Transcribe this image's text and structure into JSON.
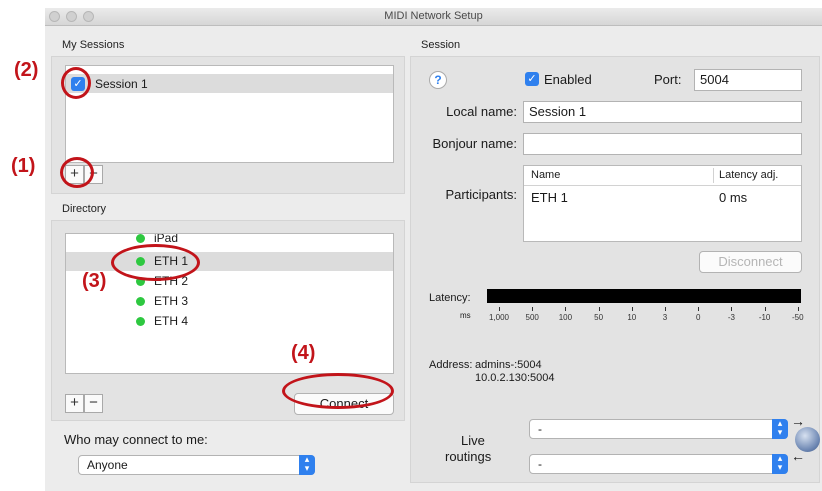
{
  "window": {
    "title": "MIDI Network Setup"
  },
  "my_sessions": {
    "header": "My Sessions",
    "items": [
      {
        "label": "Session 1",
        "checked": true
      }
    ],
    "add_symbol": "+",
    "remove_symbol": "−"
  },
  "directory": {
    "header": "Directory",
    "items": [
      "iPad",
      "ETH 1",
      "ETH 2",
      "ETH 3",
      "ETH 4"
    ],
    "status_color": "#2ec840",
    "add_symbol": "+",
    "remove_symbol": "−",
    "connect_label": "Connect"
  },
  "who_may_connect": {
    "label": "Who may connect to me:",
    "selected": "Anyone"
  },
  "session": {
    "header": "Session",
    "help_symbol": "?",
    "enabled_label": "Enabled",
    "enabled_checked": true,
    "port_label": "Port:",
    "port_value": "5004",
    "local_name_label": "Local name:",
    "local_name_value": "Session 1",
    "bonjour_name_label": "Bonjour name:",
    "bonjour_name_value": "",
    "participants_label": "Participants:",
    "participants_columns": [
      "Name",
      "Latency adj."
    ],
    "participants_rows": [
      {
        "name": "ETH 1",
        "latency": "0 ms"
      }
    ],
    "disconnect_label": "Disconnect",
    "latency_label": "Latency:",
    "latency_unit": "ms",
    "latency_ticks": [
      "1,000",
      "500",
      "100",
      "50",
      "10",
      "3",
      "0",
      "-3",
      "-10",
      "-50"
    ],
    "address_label": "Address:",
    "address_lines": [
      "admins-:5004",
      "10.0.2.130:5004"
    ],
    "live_label_1": "Live",
    "live_label_2": "routings",
    "routing_in": "-",
    "routing_out": "-"
  },
  "annotations": [
    "(1)",
    "(2)",
    "(3)",
    "(4)"
  ],
  "accent_color": "#2f80ee",
  "annotation_color": "#c2141a"
}
